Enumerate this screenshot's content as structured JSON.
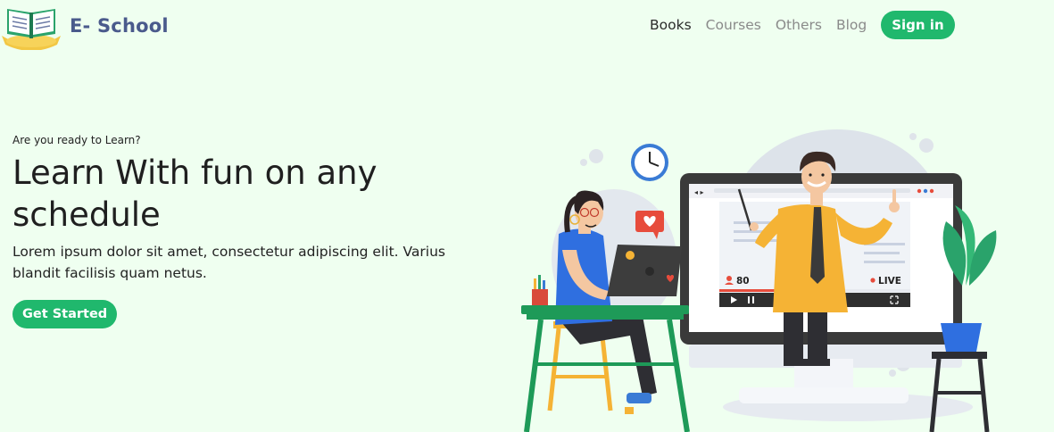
{
  "brand": {
    "name": "E- School"
  },
  "nav": {
    "items": [
      {
        "label": "Books",
        "active": true
      },
      {
        "label": "Courses",
        "active": false
      },
      {
        "label": "Others",
        "active": false
      },
      {
        "label": "Blog",
        "active": false
      }
    ],
    "signin_label": "Sign in"
  },
  "hero": {
    "eyebrow": "Are you ready to Learn?",
    "headline": "Learn With fun on any schedule",
    "body": "Lorem ipsum dolor sit amet, consectetur adipiscing elit. Varius blandit facilisis quam netus.",
    "cta_label": "Get Started"
  },
  "illustration": {
    "viewer_count": "80",
    "live_label": "LIVE"
  },
  "colors": {
    "background": "#effff0",
    "accent_green": "#20b86d",
    "brand_text": "#4a5a8c"
  }
}
